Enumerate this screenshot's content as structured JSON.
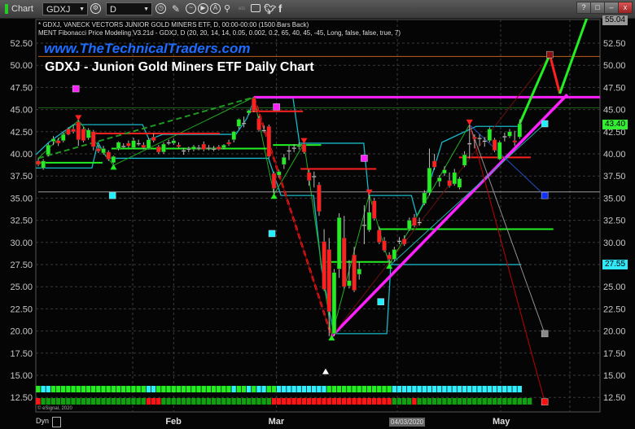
{
  "toolbar": {
    "app_label": "Chart",
    "symbol": "GDXJ",
    "interval": "D",
    "icons": [
      "link-icon",
      "clock-icon",
      "pencil-icon",
      "chart-icon",
      "play-icon",
      "alert-icon",
      "draw-icon",
      "ets-icon",
      "comment-icon",
      "twitter-icon",
      "facebook-icon"
    ],
    "ets_label": "ets",
    "window_buttons": [
      "?",
      "□",
      "–",
      "▢",
      "x"
    ]
  },
  "header": {
    "line1": "* GDXJ, VANECK VECTORS JUNIOR GOLD MINERS ETF, D, 00:00-00:00 (1500 Bars Back)",
    "line2": "MENT Fibonacci Price Modeling V3.21d - GDXJ, D (20, 20, 14, 14, 0.05, 0.002, 0.2, 65, 40, 45, -45, Long, false, false, true, 7)"
  },
  "watermark": "www.TheTechnicalTraders.com",
  "copyright": "© eSignal, 2020",
  "dyn_label": "Dyn",
  "colors": {
    "up": "#22ee22",
    "down": "#ff2020",
    "magenta": "#ff20ff",
    "cyan": "#20e0f0",
    "grid": "#3a3a3a"
  },
  "price_tags": {
    "top": "55.04",
    "last": "43.40",
    "cyan": "27.55"
  },
  "chart_data": {
    "type": "candlestick",
    "title": "GDXJ - Junion Gold Miners ETF Daily Chart",
    "ylim": [
      10.5,
      55.5
    ],
    "yticks": [
      "52.50",
      "50.00",
      "47.50",
      "45.00",
      "42.50",
      "40.00",
      "37.50",
      "35.00",
      "32.50",
      "30.00",
      "27.50",
      "25.00",
      "22.50",
      "20.00",
      "17.50",
      "15.00",
      "12.50"
    ],
    "xticks": [
      {
        "label": "Feb",
        "bar": 27
      },
      {
        "label": "Mar",
        "bar": 47.5
      },
      {
        "label": "04/03/2020",
        "bar": 71.6
      },
      {
        "label": "May",
        "bar": 92.2
      }
    ],
    "grid": true,
    "ohlc": [
      [
        39.2,
        39.5,
        38.6,
        38.8
      ],
      [
        38.4,
        39.4,
        38.2,
        39.2
      ],
      [
        39.9,
        41.2,
        39.7,
        41.0
      ],
      [
        41.4,
        42.0,
        41.0,
        41.7
      ],
      [
        41.5,
        41.8,
        40.9,
        41.2
      ],
      [
        41.5,
        42.4,
        41.3,
        42.2
      ],
      [
        42.8,
        43.0,
        42.1,
        42.2
      ],
      [
        42.8,
        43.3,
        42.3,
        42.5
      ],
      [
        43.6,
        43.8,
        40.9,
        41.6
      ],
      [
        42.8,
        43.0,
        41.3,
        41.5
      ],
      [
        41.8,
        42.9,
        41.6,
        42.7
      ],
      [
        42.5,
        42.7,
        40.4,
        40.8
      ],
      [
        40.6,
        41.0,
        40.1,
        40.3
      ],
      [
        40.1,
        40.9,
        39.9,
        40.6
      ],
      [
        40.2,
        40.4,
        39.2,
        39.4
      ],
      [
        39.0,
        39.8,
        38.9,
        39.7
      ],
      [
        40.6,
        41.4,
        40.4,
        41.3
      ],
      [
        40.9,
        41.2,
        40.7,
        40.9
      ],
      [
        41.2,
        41.5,
        40.7,
        40.9
      ],
      [
        40.7,
        41.8,
        40.6,
        41.5
      ],
      [
        41.2,
        41.6,
        40.9,
        41.2
      ],
      [
        41.0,
        41.3,
        40.5,
        40.7
      ],
      [
        40.6,
        41.8,
        40.5,
        41.6
      ],
      [
        41.9,
        42.3,
        41.3,
        41.5
      ],
      [
        40.8,
        41.0,
        40.0,
        40.2
      ],
      [
        40.2,
        41.3,
        40.0,
        41.1
      ],
      [
        41.3,
        41.6,
        41.0,
        41.3
      ],
      [
        41.2,
        41.7,
        41.0,
        41.5
      ],
      [
        41.0,
        41.3,
        40.6,
        40.8
      ],
      [
        40.4,
        40.7,
        39.9,
        40.4
      ],
      [
        40.6,
        40.8,
        40.2,
        40.6
      ],
      [
        40.5,
        41.0,
        40.3,
        40.8
      ],
      [
        40.7,
        41.0,
        40.4,
        40.7
      ],
      [
        41.1,
        41.4,
        40.3,
        40.5
      ],
      [
        40.7,
        41.0,
        40.4,
        40.7
      ],
      [
        40.6,
        40.9,
        40.3,
        40.6
      ],
      [
        40.8,
        41.0,
        40.4,
        40.5
      ],
      [
        40.7,
        41.1,
        40.5,
        41.0
      ],
      [
        41.3,
        41.6,
        40.9,
        41.1
      ],
      [
        41.6,
        42.6,
        41.3,
        42.5
      ],
      [
        43.1,
        44.0,
        42.8,
        43.9
      ],
      [
        43.5,
        44.2,
        43.0,
        43.5
      ],
      [
        44.6,
        45.0,
        44.4,
        44.9
      ],
      [
        46.3,
        46.4,
        44.7,
        44.9
      ],
      [
        44.0,
        44.3,
        42.5,
        42.7
      ],
      [
        42.7,
        43.2,
        42.4,
        42.7
      ],
      [
        43.1,
        43.3,
        39.5,
        39.7
      ],
      [
        37.8,
        38.0,
        35.4,
        36.1
      ],
      [
        37.6,
        38.2,
        37.3,
        38.0
      ],
      [
        38.8,
        40.0,
        38.3,
        39.6
      ],
      [
        40.4,
        40.9,
        39.3,
        40.4
      ],
      [
        40.7,
        41.1,
        40.2,
        40.7
      ],
      [
        40.8,
        41.3,
        40.5,
        41.0
      ],
      [
        41.1,
        41.2,
        40.0,
        40.2
      ],
      [
        37.9,
        38.2,
        36.4,
        37.0
      ],
      [
        37.5,
        38.0,
        36.2,
        37.5
      ],
      [
        36.5,
        36.8,
        33.0,
        33.5
      ],
      [
        30.1,
        31.5,
        24.5,
        24.7
      ],
      [
        29.2,
        30.5,
        19.4,
        22.2
      ],
      [
        19.7,
        27.0,
        19.4,
        26.6
      ],
      [
        27.0,
        33.3,
        26.0,
        32.8
      ],
      [
        30.5,
        33.0,
        24.8,
        25.0
      ],
      [
        25.1,
        28.0,
        24.8,
        25.7
      ],
      [
        28.6,
        29.5,
        24.4,
        24.6
      ],
      [
        26.4,
        27.8,
        25.8,
        27.0
      ],
      [
        32.0,
        34.2,
        29.8,
        32.0
      ],
      [
        31.4,
        35.4,
        31.2,
        33.4
      ],
      [
        34.7,
        35.0,
        32.5,
        32.7
      ],
      [
        31.4,
        31.8,
        29.8,
        30.0
      ],
      [
        30.2,
        30.6,
        28.9,
        29.1
      ],
      [
        28.6,
        28.9,
        27.5,
        28.1
      ],
      [
        28.1,
        29.5,
        27.9,
        29.2
      ],
      [
        30.2,
        30.6,
        29.8,
        30.2
      ],
      [
        30.4,
        30.8,
        29.6,
        29.8
      ],
      [
        31.5,
        32.8,
        31.3,
        32.5
      ],
      [
        32.8,
        33.2,
        31.7,
        31.9
      ],
      [
        32.3,
        32.8,
        31.9,
        32.3
      ],
      [
        34.4,
        35.9,
        34.2,
        35.6
      ],
      [
        35.6,
        40.6,
        35.3,
        38.4
      ],
      [
        39.2,
        40.0,
        38.2,
        38.5
      ],
      [
        36.9,
        37.6,
        36.3,
        37.3
      ],
      [
        37.8,
        38.6,
        37.5,
        38.2
      ],
      [
        37.0,
        37.9,
        36.2,
        36.4
      ],
      [
        36.6,
        38.3,
        36.4,
        37.9
      ],
      [
        36.2,
        37.4,
        36.0,
        37.2
      ],
      [
        38.7,
        40.3,
        38.5,
        39.9
      ],
      [
        41.2,
        43.3,
        39.5,
        41.2
      ],
      [
        41.9,
        42.2,
        40.6,
        41.7
      ],
      [
        41.8,
        42.2,
        40.9,
        41.8
      ],
      [
        41.5,
        41.9,
        40.8,
        41.5
      ],
      [
        41.5,
        43.0,
        41.3,
        42.8
      ],
      [
        41.6,
        41.8,
        40.2,
        40.4
      ],
      [
        39.4,
        41.5,
        39.3,
        41.3
      ],
      [
        42.0,
        42.4,
        41.4,
        42.0
      ],
      [
        42.0,
        42.8,
        41.8,
        42.5
      ],
      [
        41.5,
        42.6,
        40.9,
        41.3
      ],
      [
        41.9,
        43.9,
        41.7,
        43.4
      ]
    ],
    "horizontal_levels": [
      {
        "price": 51.0,
        "color": "#c0601a",
        "from": 0,
        "width": 1
      },
      {
        "price": 45.2,
        "color": "#1f6a1f",
        "from": 0,
        "width": 1
      },
      {
        "price": 35.7,
        "color": "#9a9a9a",
        "from": 0,
        "width": 1
      },
      {
        "price": 46.4,
        "color": "#ff20ff",
        "from": 43,
        "width": 3
      }
    ],
    "segments": [
      {
        "from": [
          -0.5,
          39.0
        ],
        "to": [
          12.8,
          39.0
        ],
        "color": "#22ee22",
        "width": 2
      },
      {
        "from": [
          14.6,
          40.6
        ],
        "to": [
          46.3,
          40.6
        ],
        "color": "#22ee22",
        "width": 2
      },
      {
        "from": [
          46.8,
          41.0
        ],
        "to": [
          56.4,
          41.0
        ],
        "color": "#22ee22",
        "width": 2
      },
      {
        "from": [
          57.5,
          27.8
        ],
        "to": [
          70.5,
          27.8
        ],
        "color": "#22ee22",
        "width": 2
      },
      {
        "from": [
          68.0,
          31.5
        ],
        "to": [
          102.7,
          31.5
        ],
        "color": "#22ee22",
        "width": 2
      },
      {
        "from": [
          10.5,
          42.3
        ],
        "to": [
          36.2,
          42.3
        ],
        "color": "#ff2020",
        "width": 2
      },
      {
        "from": [
          42.2,
          44.8
        ],
        "to": [
          52.8,
          44.8
        ],
        "color": "#ff2020",
        "width": 2
      },
      {
        "from": [
          52.3,
          38.3
        ],
        "to": [
          67.4,
          38.3
        ],
        "color": "#ff2020",
        "width": 2
      },
      {
        "from": [
          83.9,
          39.6
        ],
        "to": [
          98.2,
          39.6
        ],
        "color": "#ff2020",
        "width": 2
      },
      {
        "from": [
          70.3,
          27.5
        ],
        "to": [
          96.3,
          27.5
        ],
        "color": "#20c8d8",
        "width": 1
      },
      {
        "from": [
          0,
          39.5
        ],
        "to": [
          43,
          46.4
        ],
        "color": "#1f9a1f",
        "width": 2,
        "dash": "7,4"
      },
      {
        "from": [
          43,
          46.4
        ],
        "to": [
          58.5,
          19.4
        ],
        "color": "#ff2020",
        "width": 2.5,
        "dash": "7,4"
      },
      {
        "from": [
          43,
          46.4
        ],
        "to": [
          58.5,
          19.4
        ],
        "color": "#a00000",
        "width": 1
      },
      {
        "from": [
          58.5,
          19.4
        ],
        "to": [
          105.5,
          46.7
        ],
        "color": "#ff20ff",
        "width": 3.5
      },
      {
        "from": [
          70.3,
          27.5
        ],
        "to": [
          101,
          43.4
        ],
        "color": "#20b0b0",
        "width": 1
      },
      {
        "from": [
          58.5,
          19.4
        ],
        "to": [
          102,
          51.1
        ],
        "color": "#6a1010",
        "width": 1
      },
      {
        "from": [
          86,
          43.3
        ],
        "to": [
          101,
          35.3
        ],
        "color": "#2050c0",
        "width": 1
      },
      {
        "from": [
          86,
          43.3
        ],
        "to": [
          101,
          19.7
        ],
        "color": "#909090",
        "width": 1
      },
      {
        "from": [
          86,
          43.3
        ],
        "to": [
          101,
          12.0
        ],
        "color": "#c00000",
        "width": 1
      }
    ],
    "swing_line": [
      [
        0,
        39.5
      ],
      [
        8,
        43.8
      ],
      [
        15,
        38.7
      ],
      [
        43,
        46.4
      ],
      [
        47,
        35.4
      ],
      [
        53,
        41.2
      ],
      [
        58.5,
        19.4
      ],
      [
        66,
        35.4
      ],
      [
        70,
        27.5
      ],
      [
        86,
        43.3
      ]
    ],
    "projection": [
      {
        "points": [
          [
            96,
            43.4
          ],
          [
            102,
            51.2
          ]
        ],
        "color": "#22ee22"
      },
      {
        "points": [
          [
            102,
            51.2
          ],
          [
            104,
            46.8
          ]
        ],
        "color": "#ff2020"
      },
      {
        "points": [
          [
            104,
            46.8
          ],
          [
            109.5,
            55.5
          ]
        ],
        "color": "#22ee22"
      }
    ],
    "upper_band": [
      [
        -0.5,
        39.9
      ],
      [
        2.1,
        41.3
      ],
      [
        7,
        43.3
      ],
      [
        20.8,
        43.3
      ],
      [
        22.1,
        41.6
      ],
      [
        24.8,
        42.2
      ],
      [
        39.4,
        42.2
      ],
      [
        41.6,
        44.0
      ],
      [
        43.2,
        46.3
      ],
      [
        50.8,
        46.3
      ],
      [
        52.1,
        41.2
      ],
      [
        64.9,
        41.2
      ],
      [
        65.9,
        35.3
      ],
      [
        74.4,
        35.3
      ],
      [
        75.5,
        33.0
      ],
      [
        76.8,
        34.4
      ],
      [
        80.5,
        41.3
      ],
      [
        87.3,
        43.1
      ],
      [
        95.8,
        43.1
      ]
    ],
    "lower_band": [
      [
        -0.5,
        38.4
      ],
      [
        10.7,
        38.4
      ],
      [
        11.9,
        41.3
      ],
      [
        13.5,
        39.7
      ],
      [
        14.6,
        39.5
      ],
      [
        45.9,
        39.5
      ],
      [
        48.4,
        35.3
      ],
      [
        54.9,
        35.3
      ],
      [
        56.5,
        27.0
      ],
      [
        58.9,
        19.7
      ],
      [
        69.5,
        19.7
      ],
      [
        70.3,
        27.5
      ],
      [
        96.3,
        27.5
      ]
    ],
    "markers": [
      {
        "bar": 7.5,
        "price": 47.35,
        "shape": "square",
        "color": "#ff20ff"
      },
      {
        "bar": 47.5,
        "price": 45.3,
        "shape": "square",
        "color": "#ff20ff"
      },
      {
        "bar": 65,
        "price": 39.5,
        "shape": "square",
        "color": "#ff20ff"
      },
      {
        "bar": 14.8,
        "price": 35.3,
        "shape": "square",
        "color": "#20f0ff"
      },
      {
        "bar": 46.6,
        "price": 31.0,
        "shape": "square",
        "color": "#20f0ff"
      },
      {
        "bar": 68.3,
        "price": 23.3,
        "shape": "square",
        "color": "#20f0ff"
      },
      {
        "bar": 101,
        "price": 43.4,
        "shape": "square",
        "color": "#20f0ff"
      },
      {
        "bar": 101,
        "price": 35.3,
        "shape": "square",
        "color": "#1030ff"
      },
      {
        "bar": 101,
        "price": 19.7,
        "shape": "square",
        "color": "#888888"
      },
      {
        "bar": 101,
        "price": 12.0,
        "shape": "square",
        "color": "#ff1010"
      },
      {
        "bar": 102,
        "price": 51.2,
        "shape": "square",
        "color": "#8a1010"
      },
      {
        "bar": 57.3,
        "price": 15.4,
        "shape": "tri-up",
        "color": "#ffffff"
      },
      {
        "bar": 15,
        "price": 38.5,
        "shape": "tri-up",
        "color": "#22ee22"
      },
      {
        "bar": 47,
        "price": 35.2,
        "shape": "tri-up",
        "color": "#22ee22"
      },
      {
        "bar": 58.5,
        "price": 19.2,
        "shape": "tri-up",
        "color": "#22ee22"
      },
      {
        "bar": 70,
        "price": 27.3,
        "shape": "tri-up",
        "color": "#22ee22"
      },
      {
        "bar": 8,
        "price": 44.1,
        "shape": "tri-down",
        "color": "#ff2020"
      },
      {
        "bar": 53,
        "price": 41.5,
        "shape": "tri-down",
        "color": "#ff2020"
      },
      {
        "bar": 66,
        "price": 35.7,
        "shape": "tri-down",
        "color": "#ff2020"
      },
      {
        "bar": 86,
        "price": 43.6,
        "shape": "tri-down",
        "color": "#ff2020"
      }
    ],
    "signal_row1": "gccgggggggggggggggggggccgggggggggggggggcggcgccggccccccccccgggggggggggggcccccccccccccccccccccccccc",
    "signal_row2": "rGGGGGGGGGGGGGGGGGGGGGrrrGGGGGGGGGGGGGGGGGGGGGGrrrrrrrrrrrrrrrrrrrrrrrrGGGGrGGGGGGGGGGGGGGGGGGGGGGG"
  }
}
